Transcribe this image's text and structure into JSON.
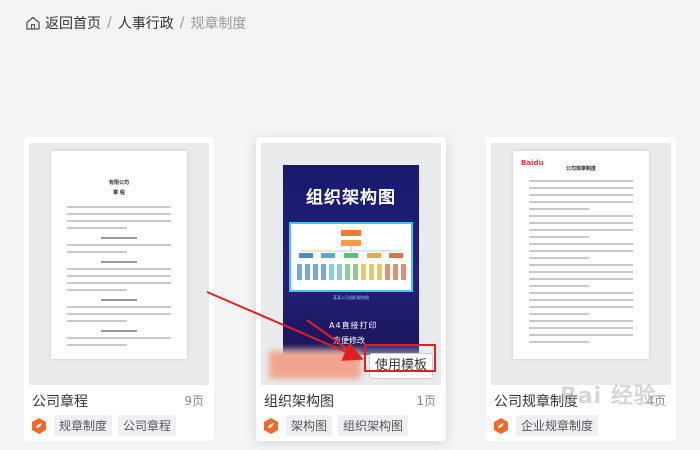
{
  "breadcrumb": {
    "home": "返回首页",
    "section": "人事行政",
    "current": "规章制度",
    "separator": "/"
  },
  "cards": [
    {
      "title": "公司章程",
      "pages": "9页",
      "tags": [
        "规章制度",
        "公司章程"
      ],
      "doc_title_line1": "有限公司",
      "doc_title_line2": "章 程"
    },
    {
      "title": "组织架构图",
      "pages": "1页",
      "tags": [
        "架构图",
        "组织架构图"
      ],
      "poster_title": "组织架构图",
      "poster_caption": "某某公司组织架构图",
      "poster_print": "A4直接打印",
      "poster_edit": "方便修改",
      "action_button": "使用模板"
    },
    {
      "title": "公司规章制度",
      "pages": "4页",
      "tags": [
        "企业规章制度"
      ],
      "doc_title_line1": "公司规章制度",
      "doc_logo": "Baidu"
    }
  ],
  "watermark": "Bai 经验",
  "colors": {
    "tag_icon": "#f06a2b",
    "highlight": "#e02020",
    "poster_bg": "#1a1a6e"
  }
}
